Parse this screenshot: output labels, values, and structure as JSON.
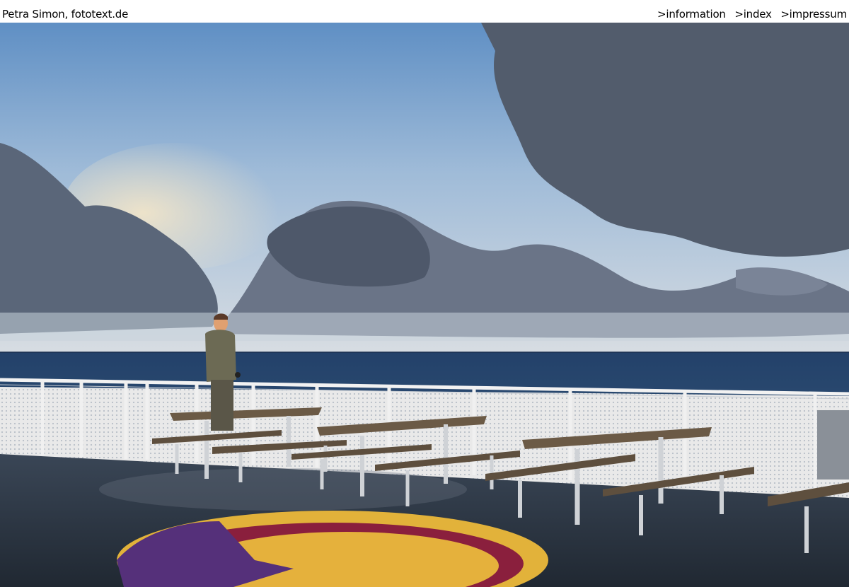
{
  "header": {
    "site_title": "Petra Simon, fototext.de",
    "nav": [
      {
        "label": ">information"
      },
      {
        "label": ">index"
      },
      {
        "label": ">impressum"
      }
    ]
  },
  "photo": {
    "subject": "ferry-deck-sea-clouds",
    "colors": {
      "sky_top": "#6e9ac8",
      "sky_low": "#c9d6e3",
      "cloud_dark": "#5b6576",
      "sea": "#1f3a5e",
      "deck": "#2c3542",
      "helipad_yellow": "#e2b23a",
      "helipad_red": "#8a1f3d",
      "railing": "#e6e6e6"
    }
  }
}
